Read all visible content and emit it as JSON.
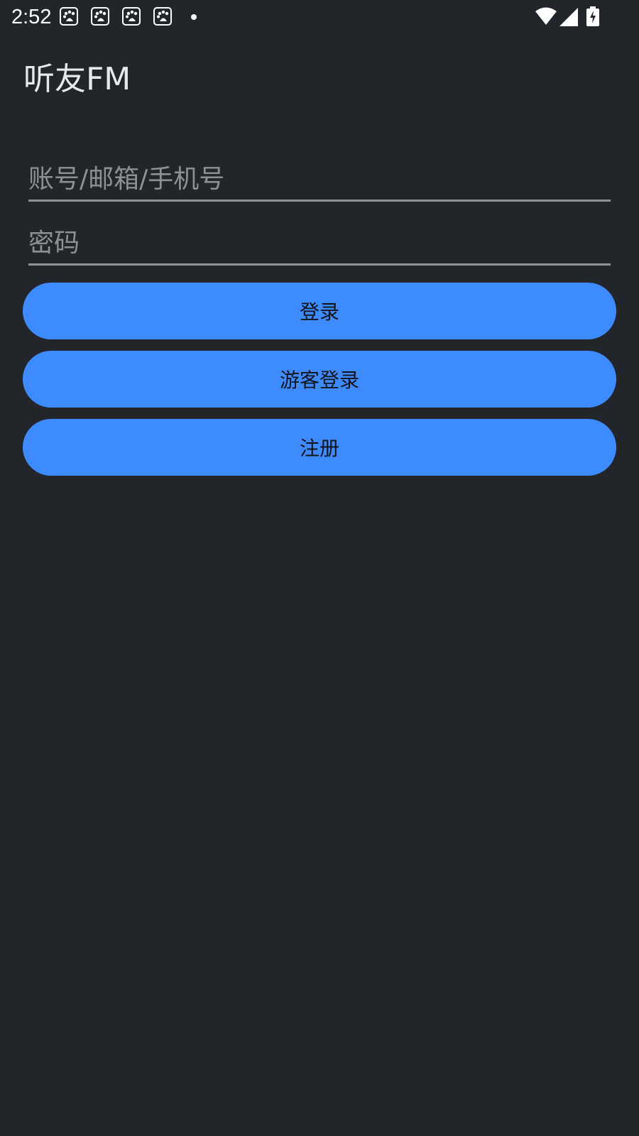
{
  "status_bar": {
    "time": "2:52",
    "notification_icons": [
      "baidu-icon",
      "baidu-icon",
      "baidu-icon",
      "baidu-icon"
    ],
    "indicators": [
      "wifi-icon",
      "signal-icon",
      "battery-charging-icon"
    ]
  },
  "app": {
    "title": "听友FM"
  },
  "login_form": {
    "account_placeholder": "账号/邮箱/手机号",
    "account_value": "",
    "password_placeholder": "密码",
    "password_value": ""
  },
  "buttons": {
    "login_label": "登录",
    "guest_login_label": "游客登录",
    "register_label": "注册"
  },
  "colors": {
    "background": "#22262b",
    "button": "#3e8bff",
    "button_text": "#111418",
    "title_text": "#e6e8ea",
    "placeholder": "#8d9196",
    "underline": "#8f9398"
  }
}
